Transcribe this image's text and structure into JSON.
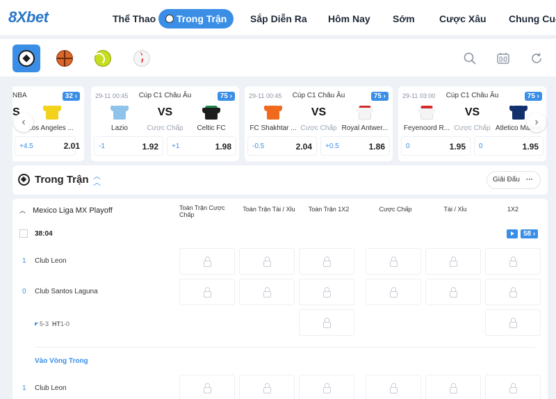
{
  "header": {
    "logo": {
      "part1": "8X",
      "part2": "bet"
    },
    "nav": [
      {
        "label": "Thể Thao",
        "active": false
      },
      {
        "label": "Trong Trận",
        "active": true
      },
      {
        "label": "Sắp Diễn Ra",
        "active": false
      },
      {
        "label": "Hôm Nay",
        "active": false
      },
      {
        "label": "Sớm",
        "active": false
      },
      {
        "label": "Cược Xâu",
        "active": false
      },
      {
        "label": "Chung Cuộc",
        "active": false
      }
    ]
  },
  "sports": [
    "soccer-icon",
    "basketball-icon",
    "tennis-icon",
    "baseball-icon"
  ],
  "tools": [
    "search-icon",
    "scoreboard-icon",
    "refresh-icon"
  ],
  "cards": [
    {
      "league": "NBA",
      "count": "32",
      "home": "S",
      "away": "Los Angeles ...",
      "handicap_label": "",
      "odds": [
        {
          "line": "+4.5",
          "price": ""
        },
        {
          "line": "",
          "price": "2.01"
        }
      ]
    },
    {
      "date": "29-11 00:45",
      "league": "Cúp C1 Châu Âu",
      "count": "75",
      "vs": "VS",
      "home": "Lazio",
      "handicap_label": "Cược Chấp",
      "away": "Celtic FC",
      "odds": [
        {
          "line": "-1",
          "price": "1.92"
        },
        {
          "line": "+1",
          "price": "1.98"
        }
      ]
    },
    {
      "date": "29-11 00:45",
      "league": "Cúp C1 Châu Âu",
      "count": "75",
      "vs": "VS",
      "home": "FC Shakhtar ...",
      "handicap_label": "Cược Chấp",
      "away": "Royal Antwer...",
      "odds": [
        {
          "line": "-0.5",
          "price": "2.04"
        },
        {
          "line": "+0.5",
          "price": "1.86"
        }
      ]
    },
    {
      "date": "29-11 03:00",
      "league": "Cúp C1 Châu Âu",
      "count": "75",
      "vs": "VS",
      "home": "Feyenoord R...",
      "handicap_label": "Cược Chấp",
      "away": "Atletico Madrid",
      "odds": [
        {
          "line": "0",
          "price": "1.95"
        },
        {
          "line": "0",
          "price": "1.95"
        }
      ]
    }
  ],
  "live": {
    "title": "Trong Trận",
    "tournament_button": "Giải Đấu",
    "more": "···",
    "league": "Mexico Liga MX Playoff",
    "columns": [
      "Toàn Trận Cược Chấp",
      "Toàn Trận Tài / Xỉu",
      "Toàn Trận 1X2",
      "Cược Chấp",
      "Tài / Xỉu",
      "1X2"
    ],
    "timer": "38:04",
    "market_count": "58",
    "teams": [
      {
        "score": "1",
        "name": "Club Leon"
      },
      {
        "score": "0",
        "name": "Club Santos Laguna"
      }
    ],
    "corners": "5-3",
    "ht_label": "HT",
    "ht_score": "1-0",
    "subsection": "Vào Vòng Trong",
    "next_team": {
      "score": "1",
      "name": "Club Leon"
    }
  },
  "colors": {
    "accent": "#3a8ee6",
    "bg": "#eef1f6"
  }
}
